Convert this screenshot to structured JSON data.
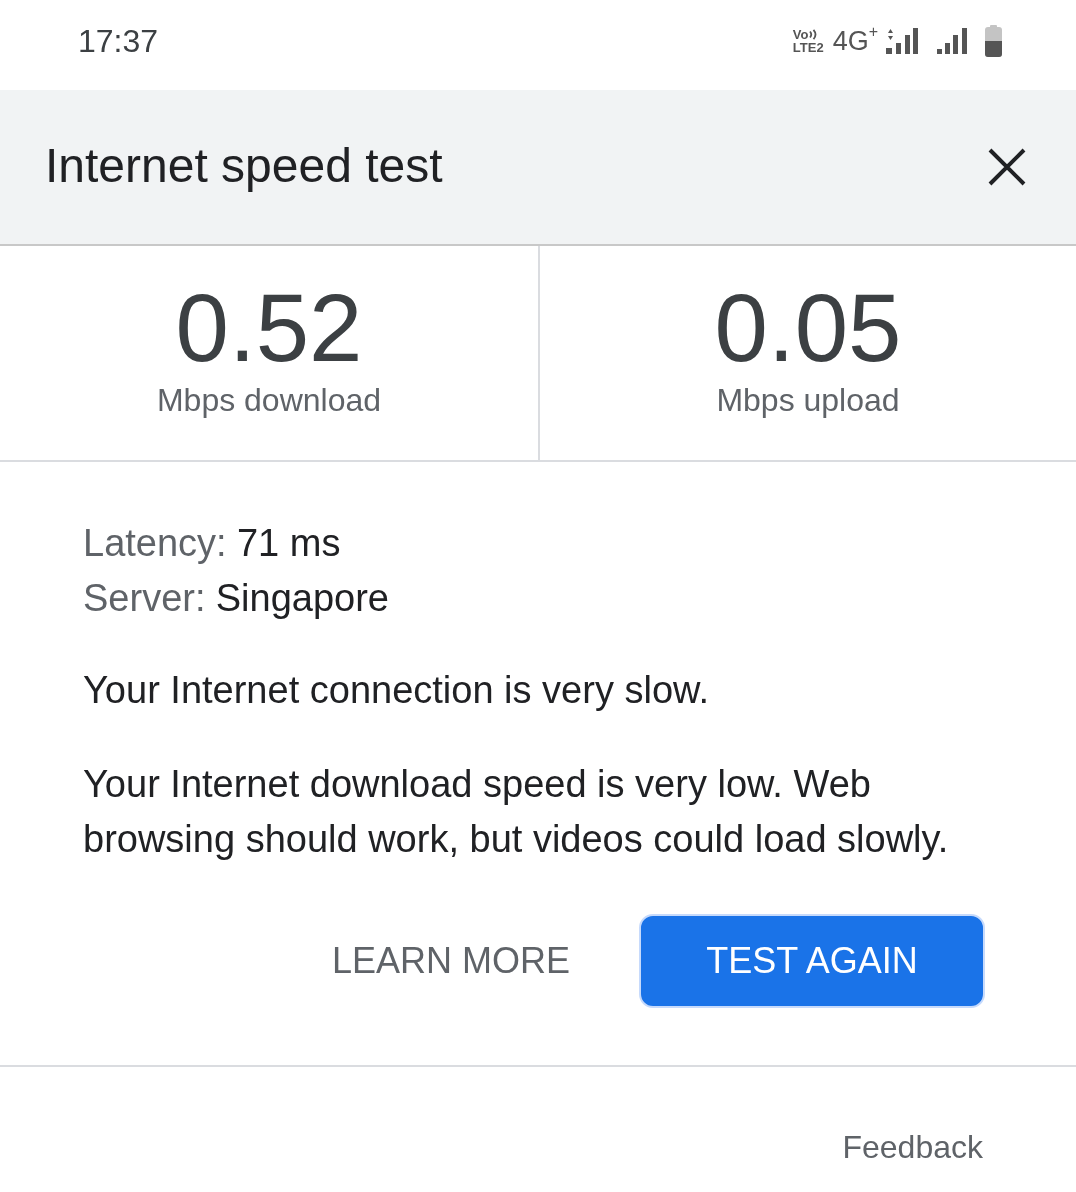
{
  "status_bar": {
    "time": "17:37",
    "volte": {
      "top": "Vo",
      "bottom": "LTE2"
    },
    "network_type": "4G$^{+}$"
  },
  "dialog": {
    "title": "Internet speed test"
  },
  "results": [
    {
      "value": "0.52",
      "unit": "Mbps download"
    },
    {
      "value": "0.05",
      "unit": "Mbps upload"
    }
  ],
  "details": [
    {
      "label": "Latency:",
      "value": "71 ms"
    },
    {
      "label": "Server:",
      "value": "Singapore"
    }
  ],
  "messages": [
    "Your Internet connection is very slow.",
    "Your Internet download speed is very low. Web browsing should work, but videos could load slowly."
  ],
  "actions": [
    {
      "label": "LEARN MORE",
      "kind": "text"
    },
    {
      "label": "TEST AGAIN",
      "kind": "filled"
    }
  ],
  "footer": {
    "link": "Feedback"
  }
}
